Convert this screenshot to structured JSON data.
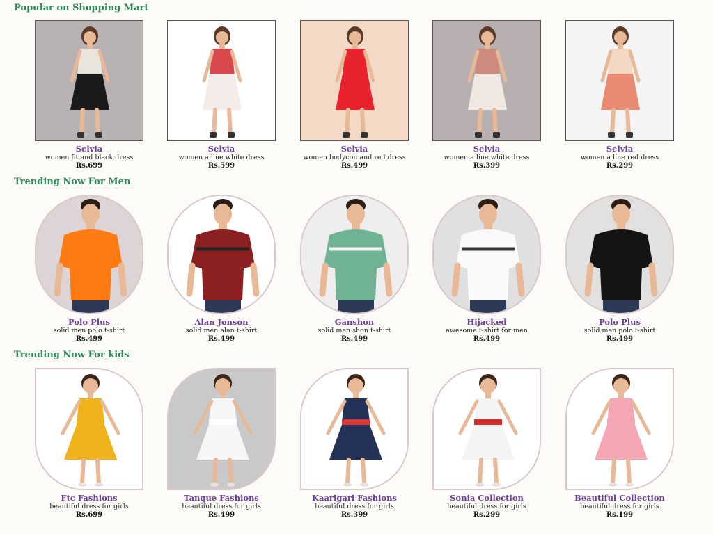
{
  "sections": [
    {
      "title": "Popular on Shopping Mart",
      "items": [
        {
          "brand": "Selvia",
          "desc": "women fit and black dress",
          "price": "Rs.699",
          "bg": "#b9b2b2",
          "garment": "#1a1a1a",
          "accent": "#e9e4dc"
        },
        {
          "brand": "Selvia",
          "desc": "women a line white dress",
          "price": "Rs.599",
          "bg": "#ffffff",
          "garment": "#f3ece9",
          "accent": "#d9484c"
        },
        {
          "brand": "Selvia",
          "desc": "women bodycon and red dress",
          "price": "Rs.499",
          "bg": "#f3d9c6",
          "garment": "#e8232e",
          "accent": "#e8232e"
        },
        {
          "brand": "Selvia",
          "desc": "women a line white dress",
          "price": "Rs.399",
          "bg": "#b8afb0",
          "garment": "#f1e8e2",
          "accent": "#cf8a80"
        },
        {
          "brand": "Selvia",
          "desc": "women a line red dress",
          "price": "Rs.299",
          "bg": "#f4f4f4",
          "garment": "#e98a72",
          "accent": "#f3d9c4"
        }
      ]
    },
    {
      "title": "Trending Now For Men",
      "items": [
        {
          "brand": "Polo Plus",
          "desc": "solid men polo t-shirt",
          "price": "Rs.499",
          "bg": "#ddd5d5",
          "garment": "#ff7a12",
          "accent": "#ff7a12"
        },
        {
          "brand": "Alan Jonson",
          "desc": "solid men alan t-shirt",
          "price": "Rs.499",
          "bg": "#ffffff",
          "garment": "#8c1f1f",
          "accent": "#222222"
        },
        {
          "brand": "Ganshon",
          "desc": "solid men shon t-shirt",
          "price": "Rs.499",
          "bg": "#eeeeee",
          "garment": "#6fb394",
          "accent": "#ffffff"
        },
        {
          "brand": "Hijacked",
          "desc": "awesome t-shirt for men",
          "price": "Rs.499",
          "bg": "#e0e0e0",
          "garment": "#fafafa",
          "accent": "#222222"
        },
        {
          "brand": "Polo Plus",
          "desc": "solid men polo t-shirt",
          "price": "Rs.499",
          "bg": "#e3e0e0",
          "garment": "#141414",
          "accent": "#141414"
        }
      ]
    },
    {
      "title": "Trending Now For kids",
      "items": [
        {
          "brand": "Ftc Fashions",
          "desc": "beautiful dress for girls",
          "price": "Rs.699",
          "bg": "#ffffff",
          "garment": "#f0b21a",
          "accent": "#f0b21a"
        },
        {
          "brand": "Tanque Fashions",
          "desc": "beautiful dress for girls",
          "price": "Rs.499",
          "bg": "#c9c9c9",
          "garment": "#f6f6f6",
          "accent": "#ffffff"
        },
        {
          "brand": "Kaarigari Fashions",
          "desc": "beautiful dress for girls",
          "price": "Rs.399",
          "bg": "#ffffff",
          "garment": "#243258",
          "accent": "#e0322e"
        },
        {
          "brand": "Sonia Collection",
          "desc": "beautiful dress for girls",
          "price": "Rs.299",
          "bg": "#ffffff",
          "garment": "#f4f4f4",
          "accent": "#d82a26"
        },
        {
          "brand": "Beautiful Collection",
          "desc": "beautiful dress for girls",
          "price": "Rs.199",
          "bg": "#ffffff",
          "garment": "#f4a6b5",
          "accent": "#f4a6b5"
        }
      ]
    }
  ]
}
